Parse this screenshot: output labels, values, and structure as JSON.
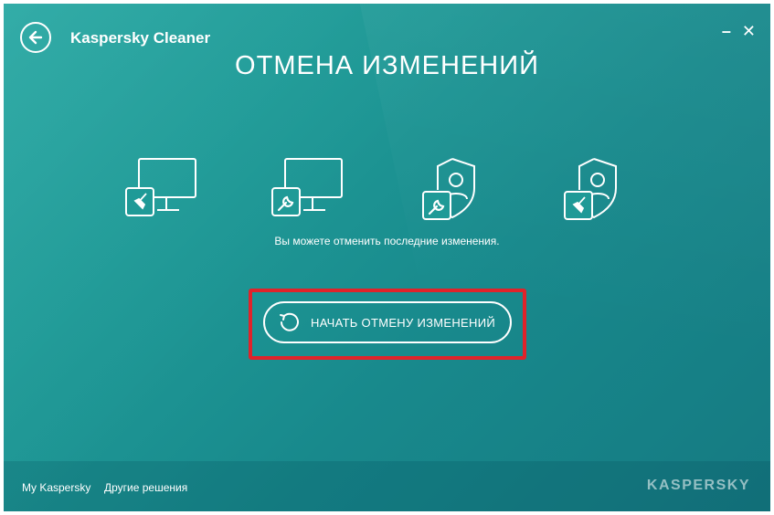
{
  "app": {
    "title": "Kaspersky Cleaner"
  },
  "window_controls": {
    "minimize": "–",
    "close": "✕"
  },
  "page": {
    "title": "ОТМЕНА ИЗМЕНЕНИЙ",
    "subtitle": "Вы можете отменить последние изменения.",
    "start_button_label": "НАЧАТЬ ОТМЕНУ ИЗМЕНЕНИЙ"
  },
  "icons": [
    {
      "name": "monitor-broom-icon"
    },
    {
      "name": "monitor-wrench-icon"
    },
    {
      "name": "shield-user-wrench-icon"
    },
    {
      "name": "shield-user-broom-icon"
    }
  ],
  "footer": {
    "my_kaspersky": "My Kaspersky",
    "other_solutions": "Другие решения",
    "logo": "KASPERSKY"
  },
  "colors": {
    "background": "#1f9a97",
    "highlight_border": "#e0232a",
    "foreground": "#ffffff"
  }
}
